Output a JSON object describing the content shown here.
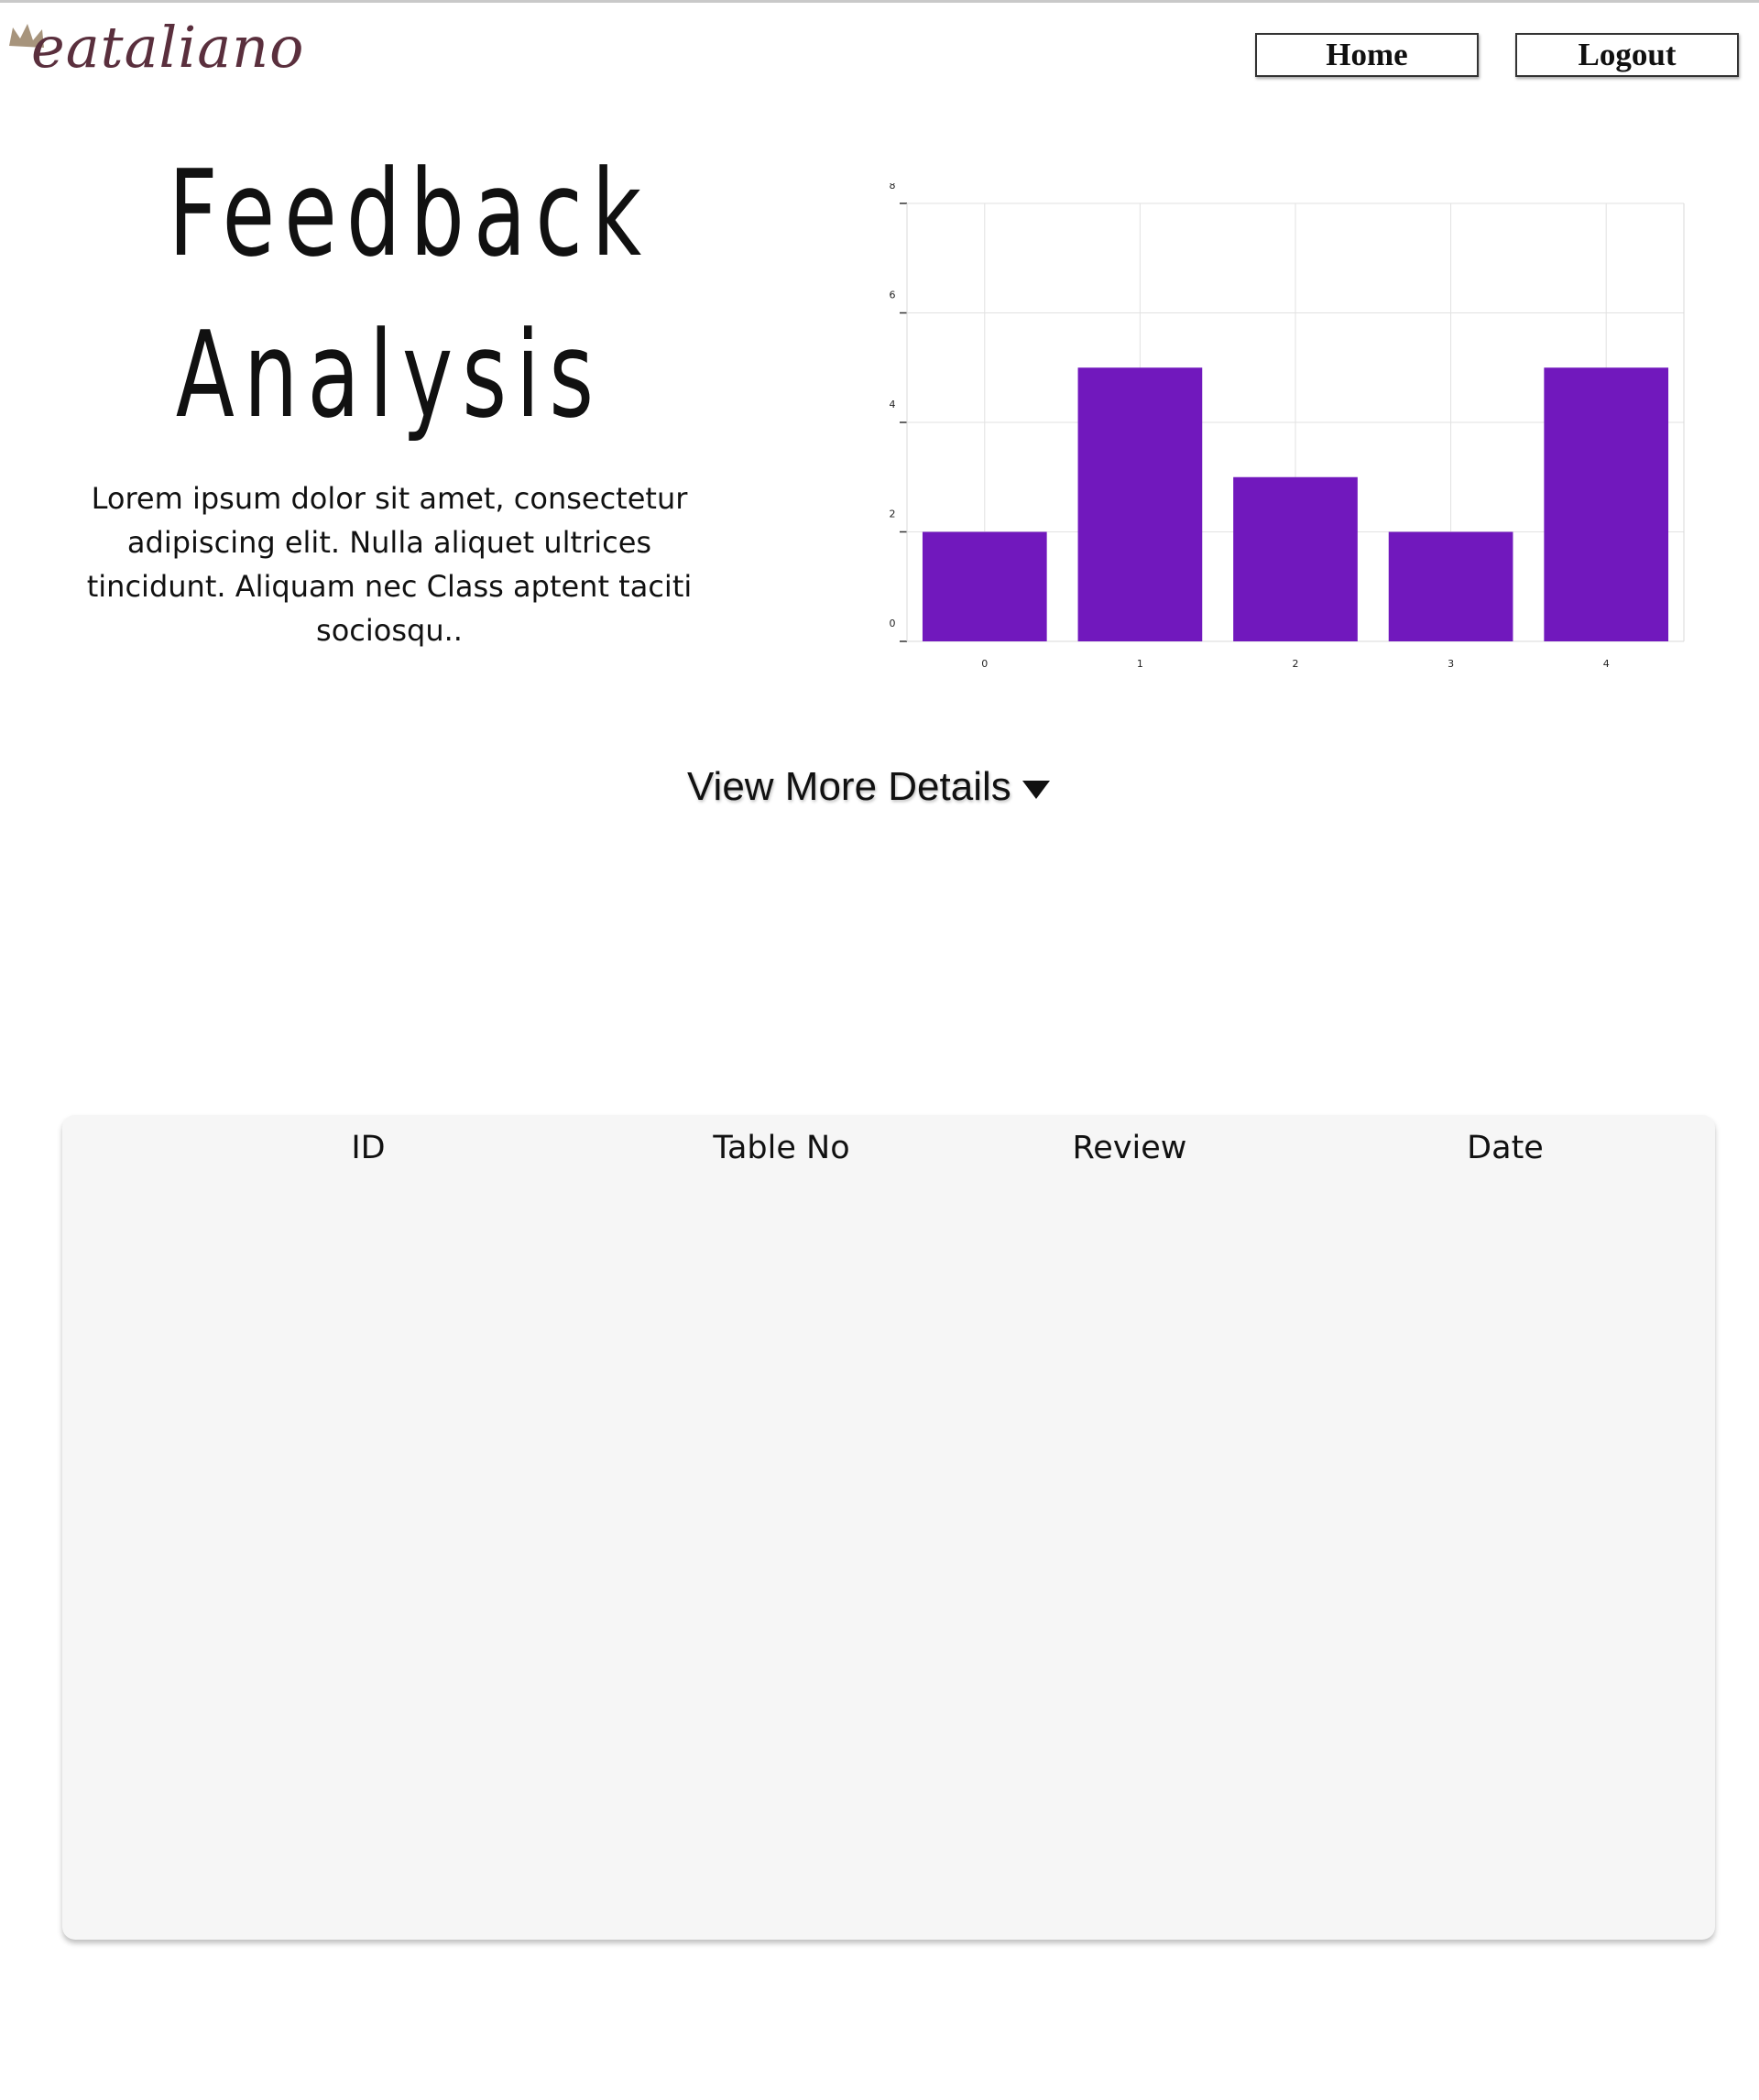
{
  "header": {
    "logo_text": "eataliano",
    "nav": {
      "home_label": "Home",
      "logout_label": "Logout"
    }
  },
  "hero": {
    "title_line1": "Feedback",
    "title_line2": "Analysis",
    "body": "Lorem ipsum dolor sit amet, consectetur adipiscing elit. Nulla aliquet ultrices tincidunt. Aliquam nec Class aptent taciti sociosqu.."
  },
  "colors": {
    "bar": "#7118bd",
    "logo": "#5a2f3d",
    "card_bg": "#f6f6f6"
  },
  "chart_data": {
    "type": "bar",
    "categories": [
      "0",
      "1",
      "2",
      "3",
      "4"
    ],
    "values": [
      2,
      5,
      3,
      2,
      5
    ],
    "y_ticks": [
      "0",
      "2",
      "4",
      "6",
      "8"
    ],
    "ylim": [
      0,
      8
    ],
    "grid": true,
    "title": "",
    "xlabel": "",
    "ylabel": ""
  },
  "details": {
    "label": "View More Details"
  },
  "table": {
    "columns": [
      "ID",
      "Table No",
      "Review",
      "Date"
    ]
  }
}
